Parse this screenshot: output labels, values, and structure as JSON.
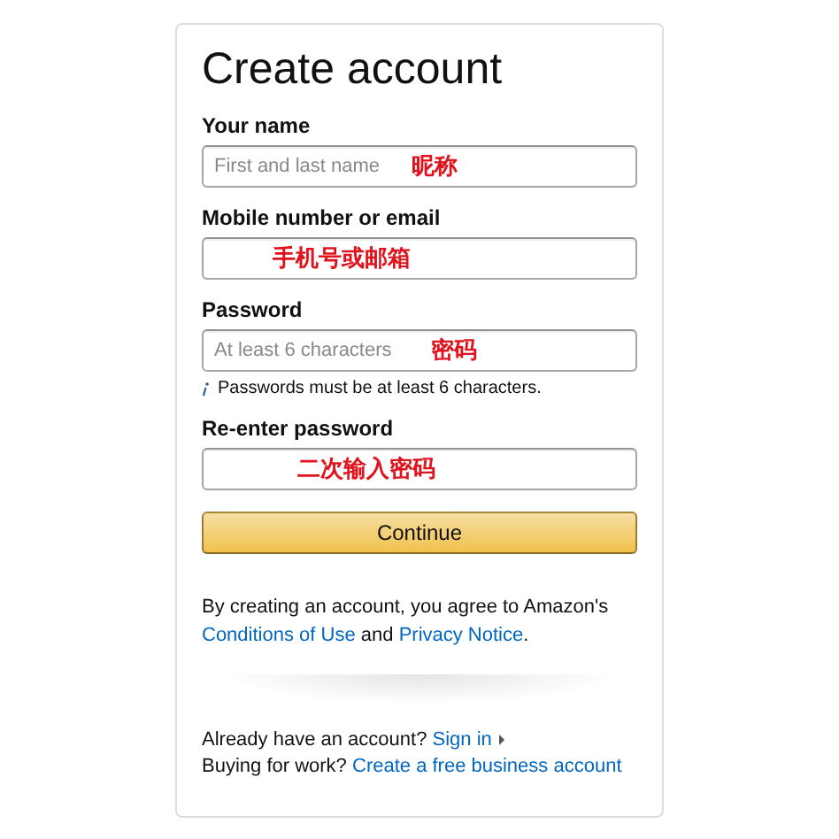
{
  "title": "Create account",
  "fields": [
    {
      "label": "Your name",
      "placeholder": "First and last name",
      "annotation": "昵称"
    },
    {
      "label": "Mobile number or email",
      "annotation": "手机号或邮箱"
    },
    {
      "label": "Password",
      "placeholder": "At least 6 characters",
      "annotation": "密码",
      "hint": "Passwords must be at least 6 characters."
    },
    {
      "label": "Re-enter password",
      "annotation": "二次输入密码"
    }
  ],
  "continue_button": "Continue",
  "legal": {
    "text": "By creating an account, you agree to Amazon's",
    "link1": "Conditions of Use",
    "joiner": "and",
    "link2": "Privacy Notice",
    "end": "."
  },
  "sign_in": {
    "text": "Already have an account?",
    "link": "Sign in"
  },
  "business": {
    "text": "Buying for work?",
    "link": "Create a free business account"
  }
}
